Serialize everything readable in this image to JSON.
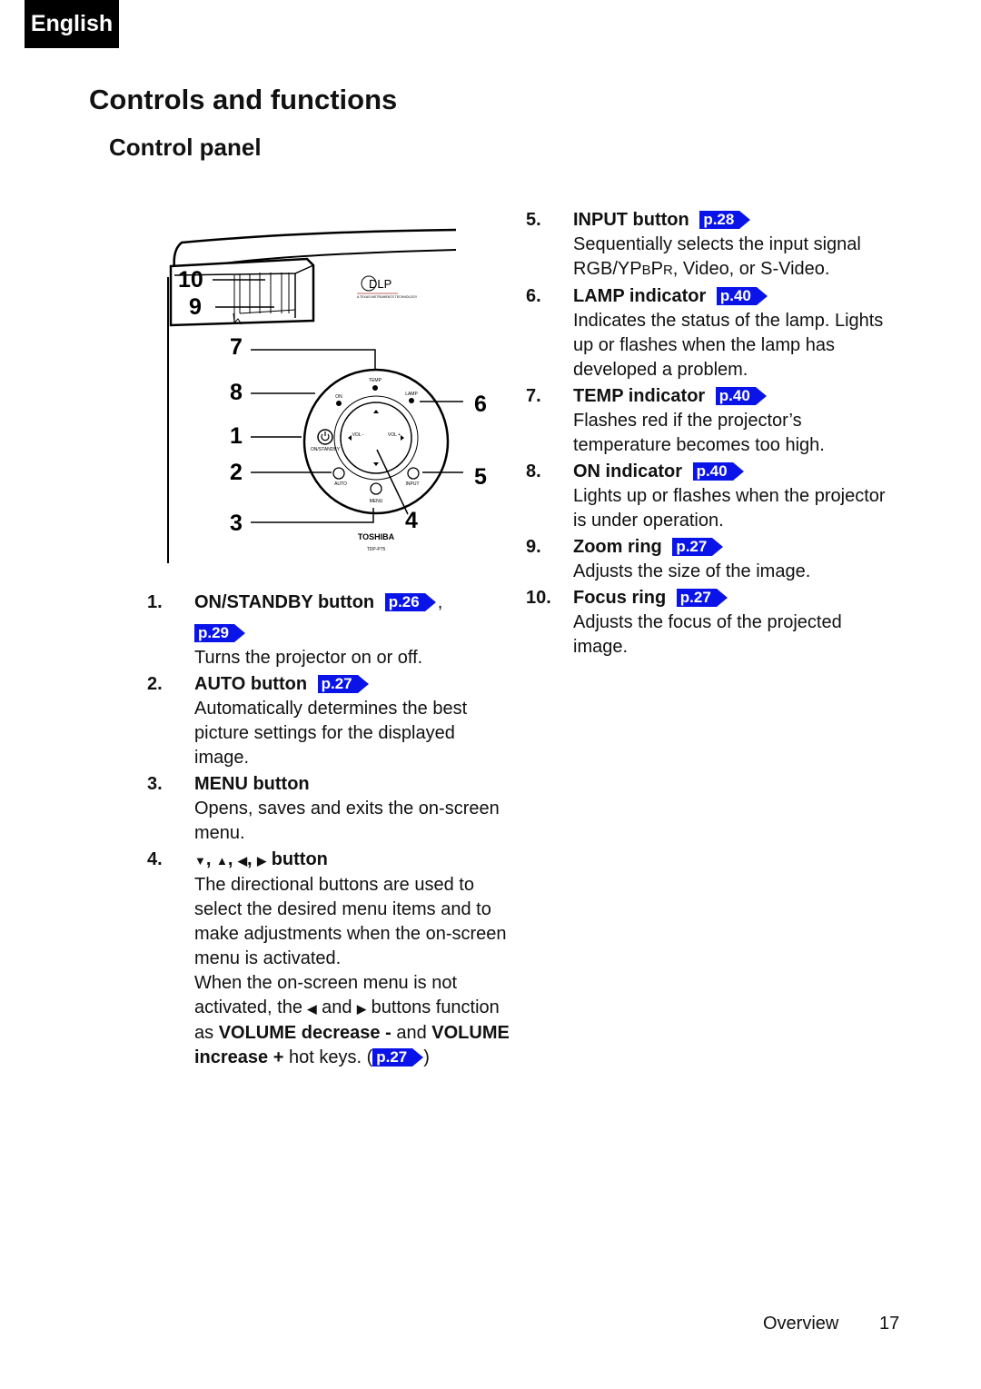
{
  "header": {
    "language_tab": "English",
    "title": "Controls and functions",
    "subtitle": "Control panel"
  },
  "diagram": {
    "callouts": [
      "10",
      "9",
      "7",
      "8",
      "1",
      "2",
      "3",
      "6",
      "5",
      "4"
    ],
    "panel_labels": {
      "temp": "TEMP",
      "on": "ON",
      "lamp": "LAMP",
      "on_standby": "ON/STANDBY",
      "auto": "AUTO",
      "input": "INPUT",
      "menu": "MENU",
      "vol_minus": "VOL -",
      "vol_plus": "VOL +",
      "brand": "TOSHIBA",
      "model": "TDP-P75",
      "dlp": "DLP",
      "dlp_tagline": "A TEXAS INSTRUMENTS TECHNOLOGY"
    }
  },
  "items": [
    {
      "num": "1.",
      "title": "ON/STANDBY button",
      "refs": [
        "p.26",
        "p.29"
      ],
      "desc": "Turns the projector on or off."
    },
    {
      "num": "2.",
      "title": "AUTO button",
      "refs": [
        "p.27"
      ],
      "desc": "Automatically determines the best picture settings for the displayed image."
    },
    {
      "num": "3.",
      "title": "MENU button",
      "refs": [],
      "desc": "Opens, saves and exits the on-screen menu."
    },
    {
      "num": "4.",
      "title_glyphs": [
        "▼",
        "▲",
        "◀",
        "▶"
      ],
      "title": "button",
      "refs": [],
      "desc": "The directional buttons are used to select the desired menu items and to make adjustments when the on-screen menu is activated.",
      "desc2_a": "When the on-screen menu is not activated, the",
      "desc2_b": "and",
      "desc2_c": "buttons function as",
      "desc2_bold1": "VOLUME decrease -",
      "desc2_d": "and",
      "desc2_bold2": "VOLUME increase +",
      "desc2_e": "hot keys. (",
      "desc2_ref": "p.27",
      "desc2_f": ")"
    },
    {
      "num": "5.",
      "title": "INPUT button",
      "refs": [
        "p.28"
      ],
      "desc_a": "Sequentially selects the input signal RGB/YP",
      "desc_sc1": "B",
      "desc_b": "P",
      "desc_sc2": "R",
      "desc_c": ", Video, or S-Video."
    },
    {
      "num": "6.",
      "title": "LAMP indicator",
      "refs": [
        "p.40"
      ],
      "desc": "Indicates the status of the lamp. Lights up or flashes when the lamp has developed a problem."
    },
    {
      "num": "7.",
      "title": "TEMP indicator",
      "refs": [
        "p.40"
      ],
      "desc": "Flashes red if the projector’s temperature becomes too high."
    },
    {
      "num": "8.",
      "title": "ON indicator",
      "refs": [
        "p.40"
      ],
      "desc": "Lights up or flashes when the projector is under operation."
    },
    {
      "num": "9.",
      "title": "Zoom ring",
      "refs": [
        "p.27"
      ],
      "desc": "Adjusts the size of the image."
    },
    {
      "num": "10.",
      "title": "Focus ring",
      "refs": [
        "p.27"
      ],
      "desc": "Adjusts the focus of the projected image."
    }
  ],
  "footer": {
    "section": "Overview",
    "page": "17"
  },
  "colors": {
    "page_ref_bg": "#0a14e8",
    "lang_tab_bg": "#000000"
  }
}
